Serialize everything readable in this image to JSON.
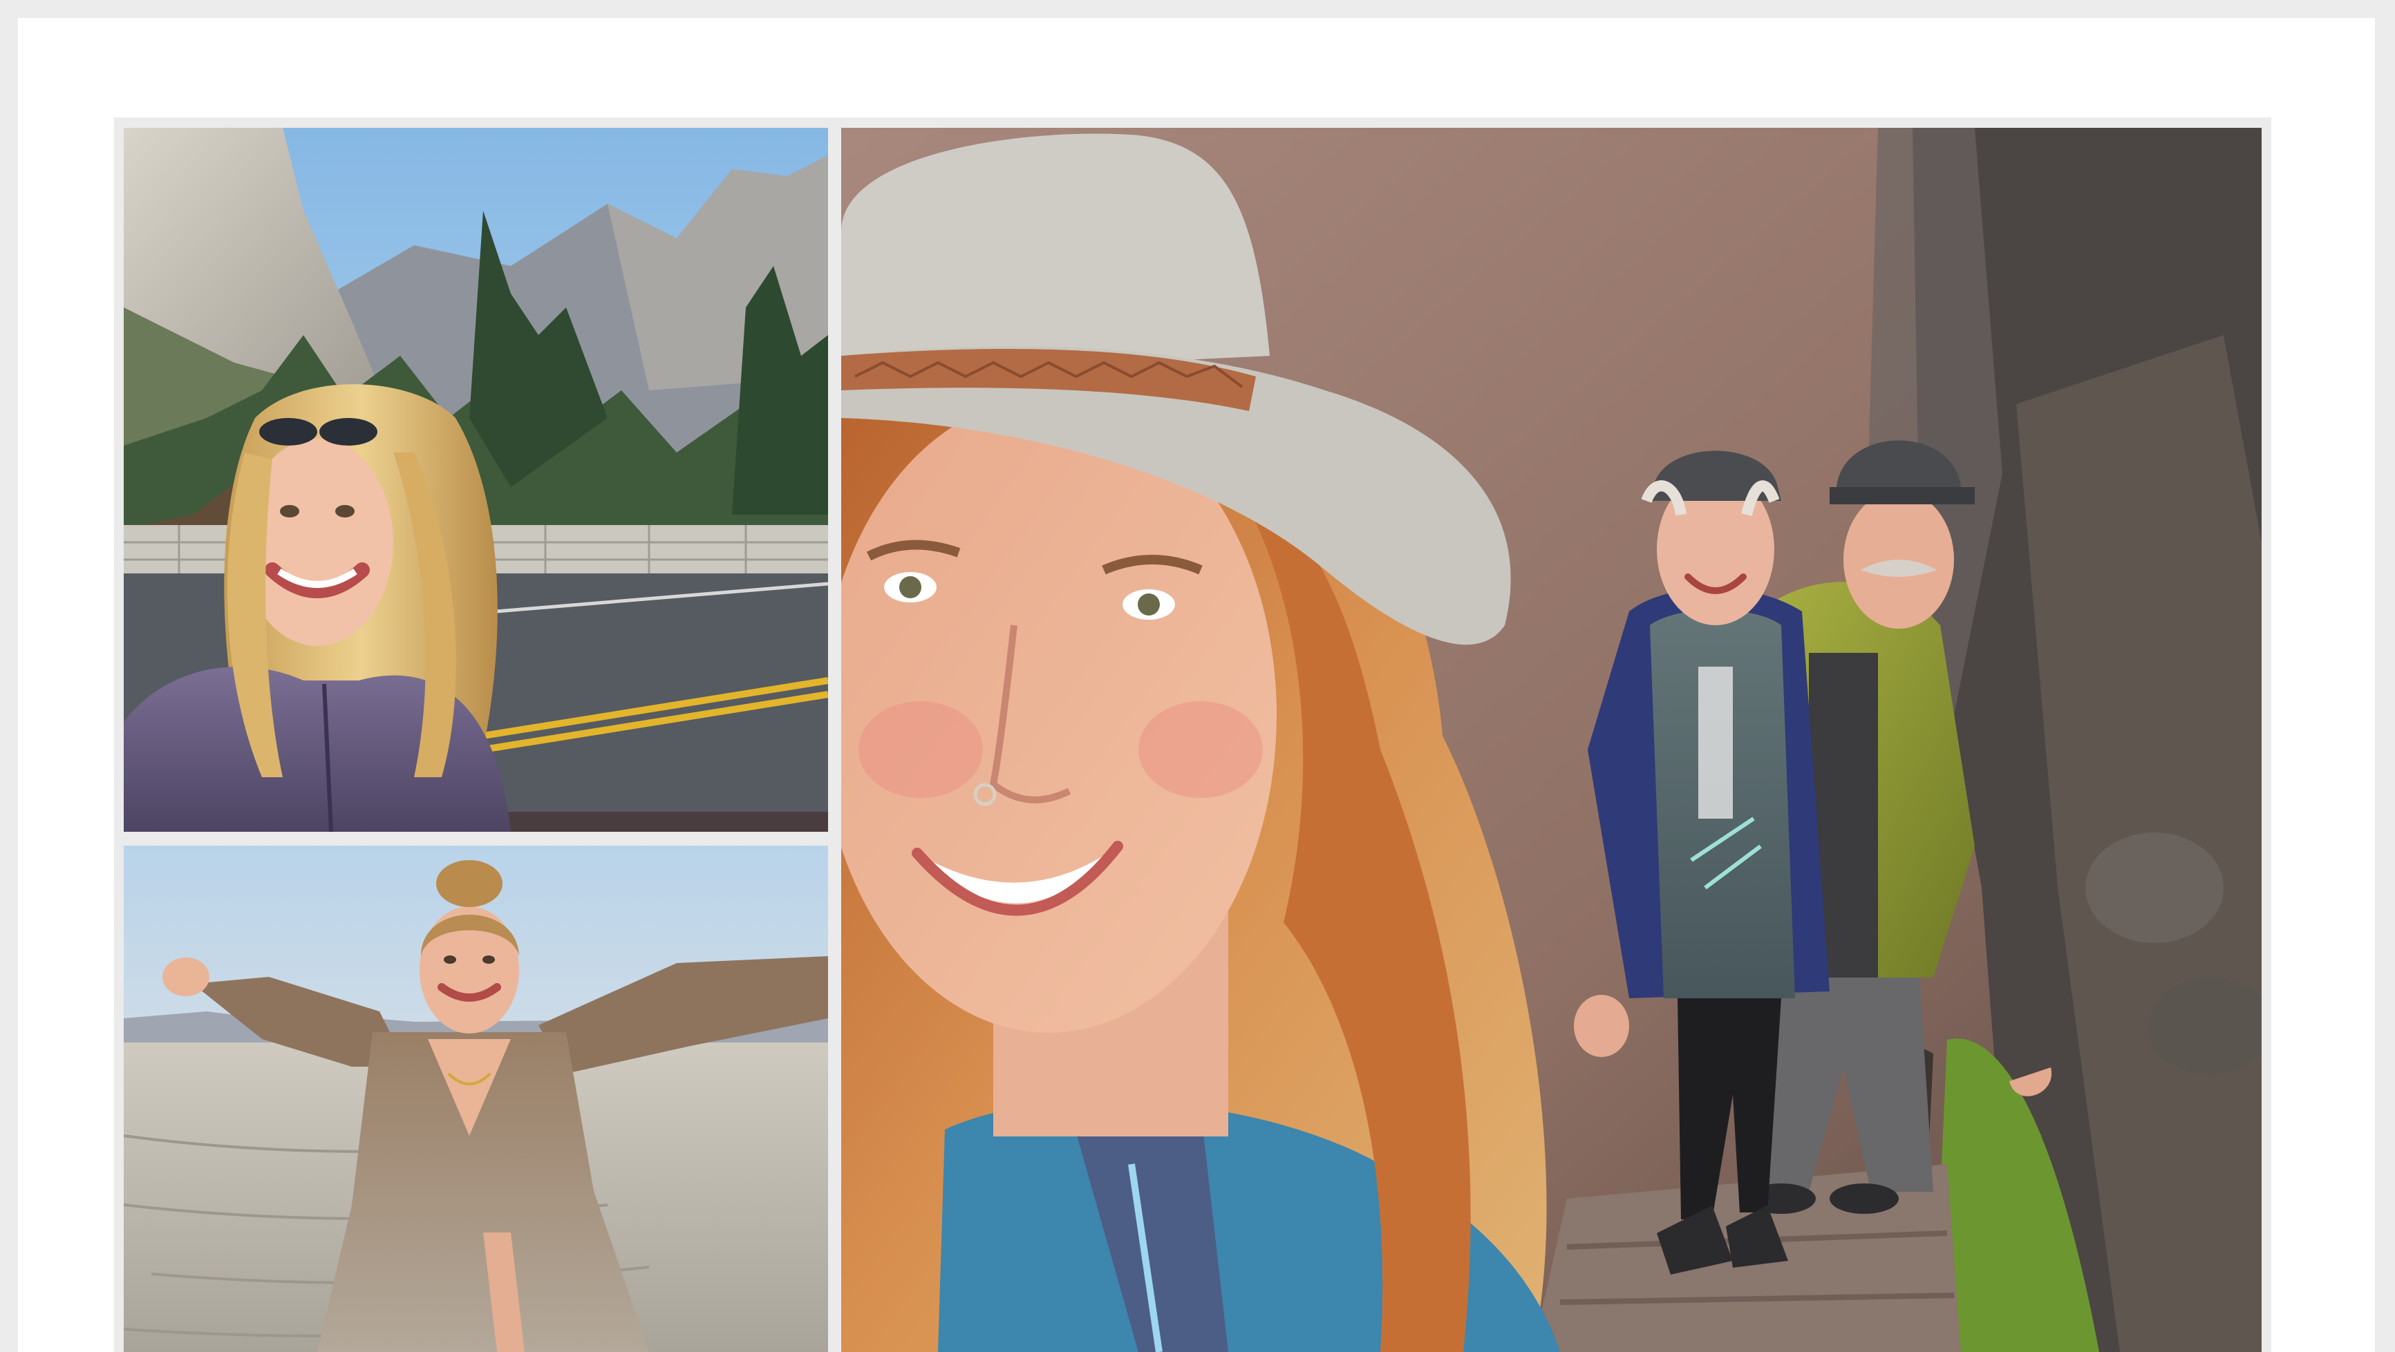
{
  "gallery": {
    "photos": [
      {
        "alt": "",
        "icon": "photo-yosemite-valley-portrait",
        "colors": {
          "sky": "#9ec6ea",
          "granite": "#c9c6bd",
          "jacket": "#62577a",
          "hair": "#e3c07a"
        }
      },
      {
        "alt": "",
        "icon": "photo-desert-playa-portrait",
        "colors": {
          "sky": "#c8dceb",
          "ground": "#c4bfb5",
          "dress": "#8d7560"
        }
      },
      {
        "alt": "",
        "icon": "photo-rock-trail-selfie",
        "colors": {
          "rock": "#9c7d72",
          "hat": "#cbc8c2",
          "hair": "#c9783f",
          "vest": "#56666a",
          "jacket": "#8f9a36",
          "moss": "#6b8e2a"
        }
      }
    ]
  }
}
